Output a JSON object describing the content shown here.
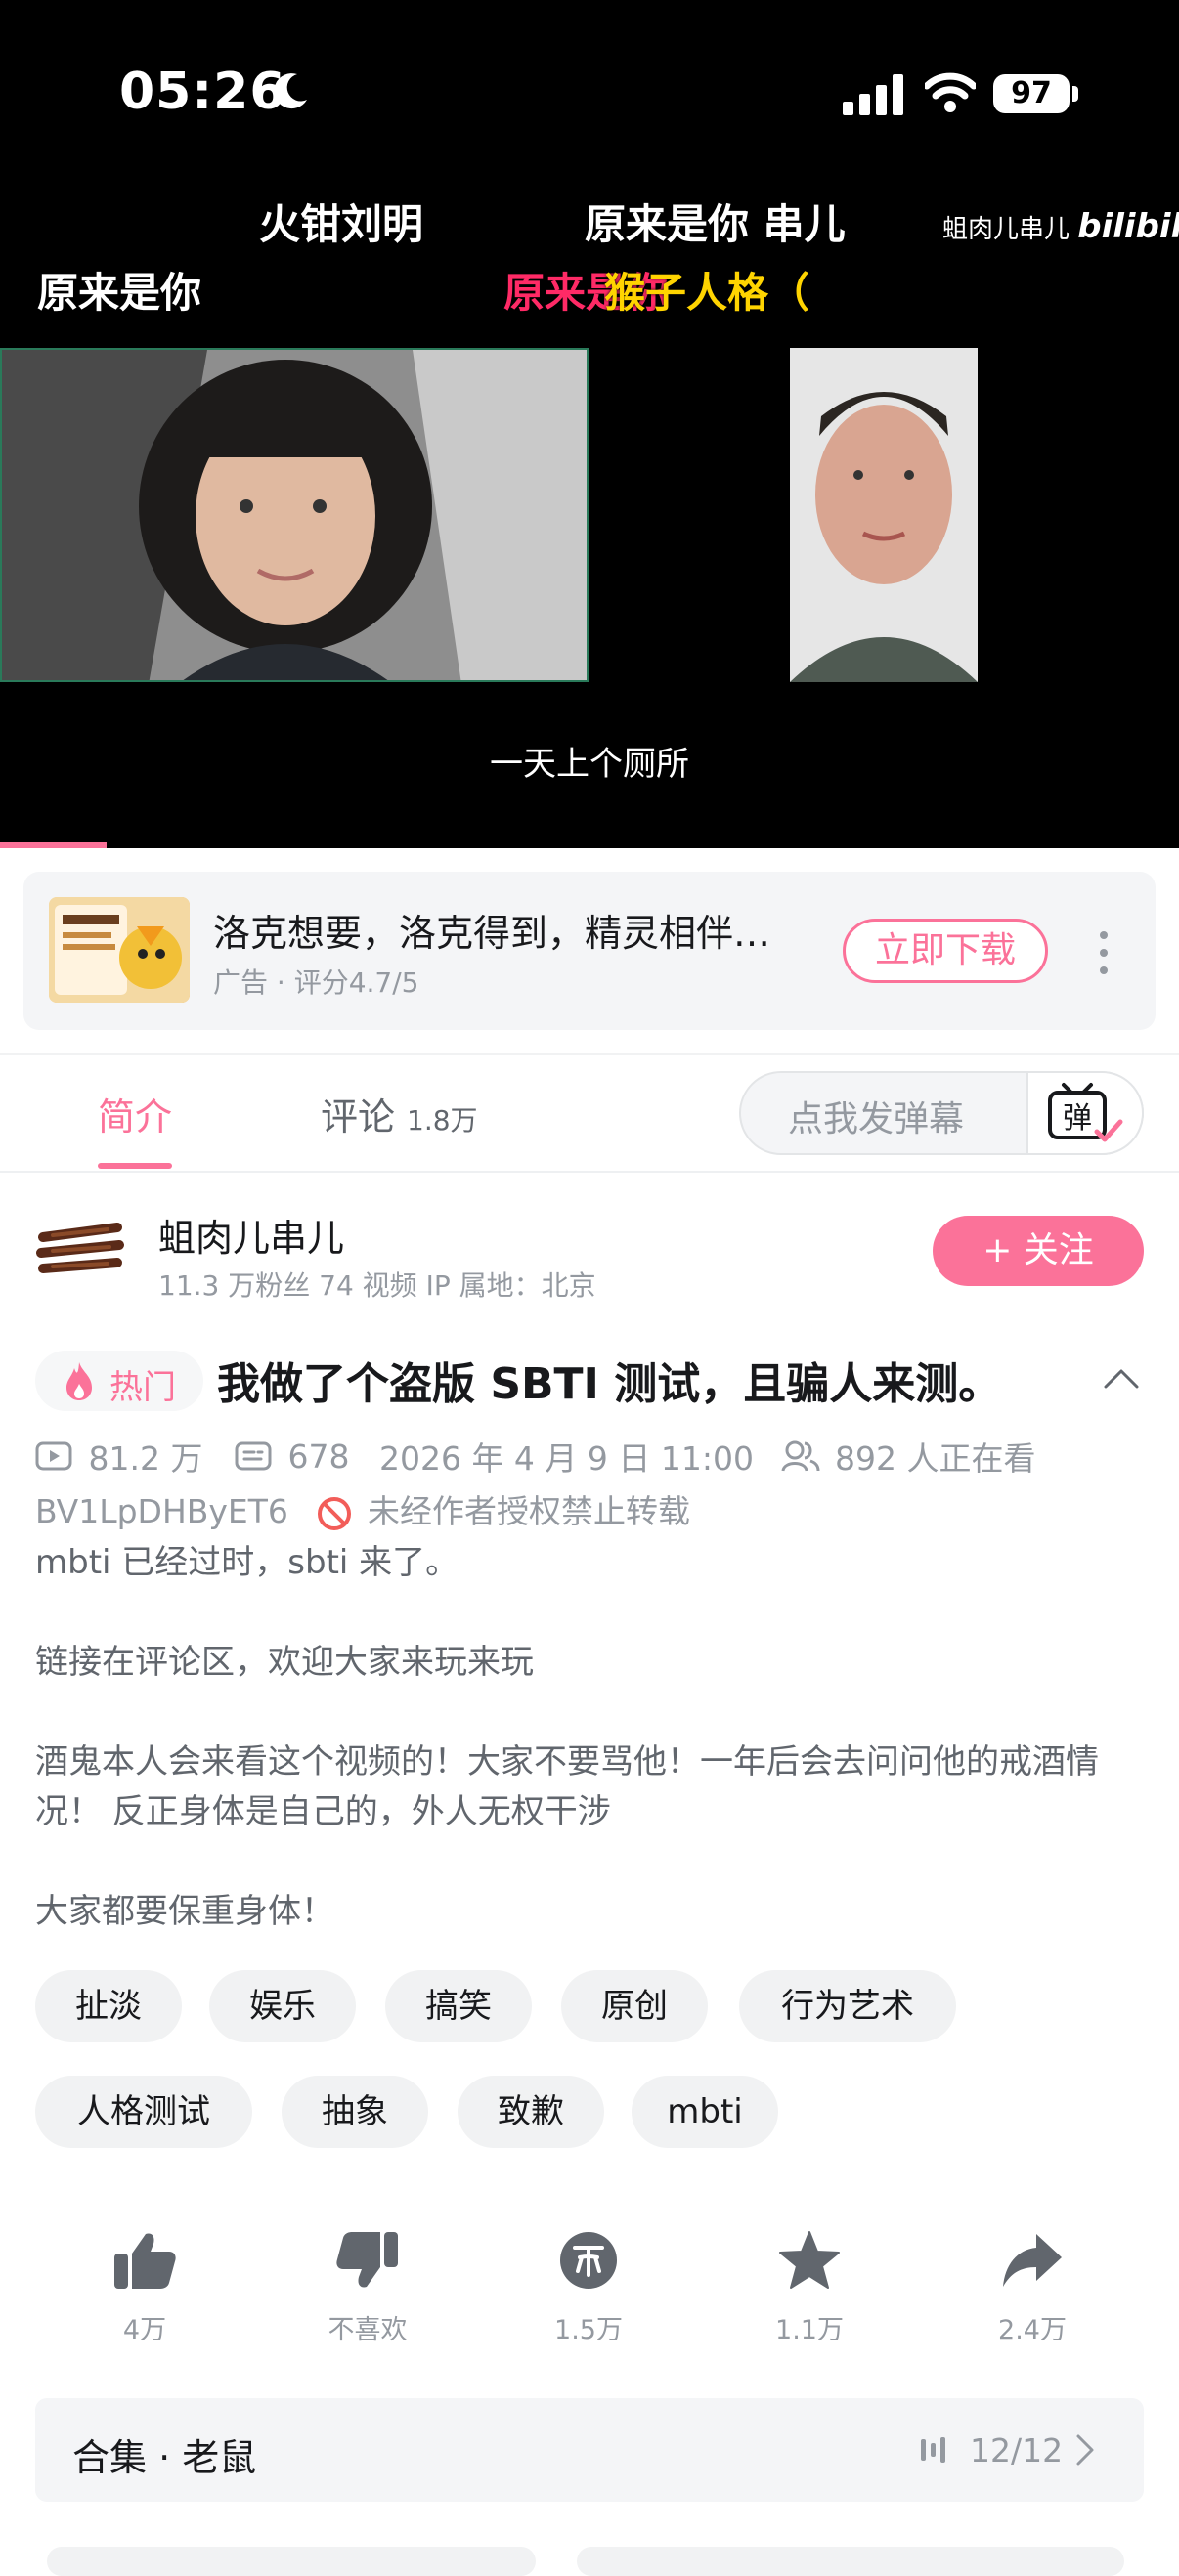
{
  "status_bar": {
    "time": "05:26",
    "battery": "97",
    "icons": [
      "moon-icon",
      "signal-icon",
      "wifi-icon",
      "battery-icon"
    ]
  },
  "video": {
    "danmaku": [
      "火钳刘明",
      "原来是你 串儿",
      "原来是你",
      "原来是你",
      "猴子人格（"
    ],
    "watermark_user": "蛆肉儿串儿",
    "watermark_logo": "bilibili",
    "subtitle": "一天上个厕所",
    "progress": 0.09
  },
  "ad": {
    "title": "洛克想要，洛克得到，精灵相伴…",
    "meta": "广告 · 评分4.7/5",
    "button": "立即下载"
  },
  "tabs": {
    "intro": "简介",
    "comments": "评论",
    "comments_count": "1.8万",
    "danmaku_placeholder": "点我发弹幕",
    "danmaku_toggle": "弹"
  },
  "uploader": {
    "name": "蛆肉儿串儿",
    "stats": "11.3 万粉丝   74 视频   IP 属地：北京",
    "follow": "+ 关注"
  },
  "video_info": {
    "hot_badge": "热门",
    "title": "我做了个盗版 SBTI 测试，且骗人来测。",
    "views": "81.2 万",
    "danmaku_count": "678",
    "date": "2026 年 4 月 9 日 11:00",
    "watching": "892 人正在看",
    "bvid": "BV1LpDHByET6",
    "no_repost": "未经作者授权禁止转载",
    "description": "mbti 已经过时，sbti 来了。\n\n链接在评论区，欢迎大家来玩来玩\n\n酒鬼本人会来看这个视频的！大家不要骂他！一年后会去问问他的戒酒情况！ 反正身体是自己的，外人无权干涉\n\n大家都要保重身体！"
  },
  "tags": [
    "扯淡",
    "娱乐",
    "搞笑",
    "原创",
    "行为艺术",
    "人格测试",
    "抽象",
    "致歉",
    "mbti"
  ],
  "actions": [
    {
      "icon": "thumbs-up-icon",
      "label": "4万"
    },
    {
      "icon": "thumbs-down-icon",
      "label": "不喜欢"
    },
    {
      "icon": "coin-icon",
      "label": "1.5万"
    },
    {
      "icon": "star-icon",
      "label": "1.1万"
    },
    {
      "icon": "share-icon",
      "label": "2.4万"
    }
  ],
  "collection": {
    "title": "合集 · 老鼠",
    "progress": "12/12"
  },
  "colors": {
    "accent": "#fb7299",
    "text": "#18191c",
    "muted": "#9499a0"
  }
}
